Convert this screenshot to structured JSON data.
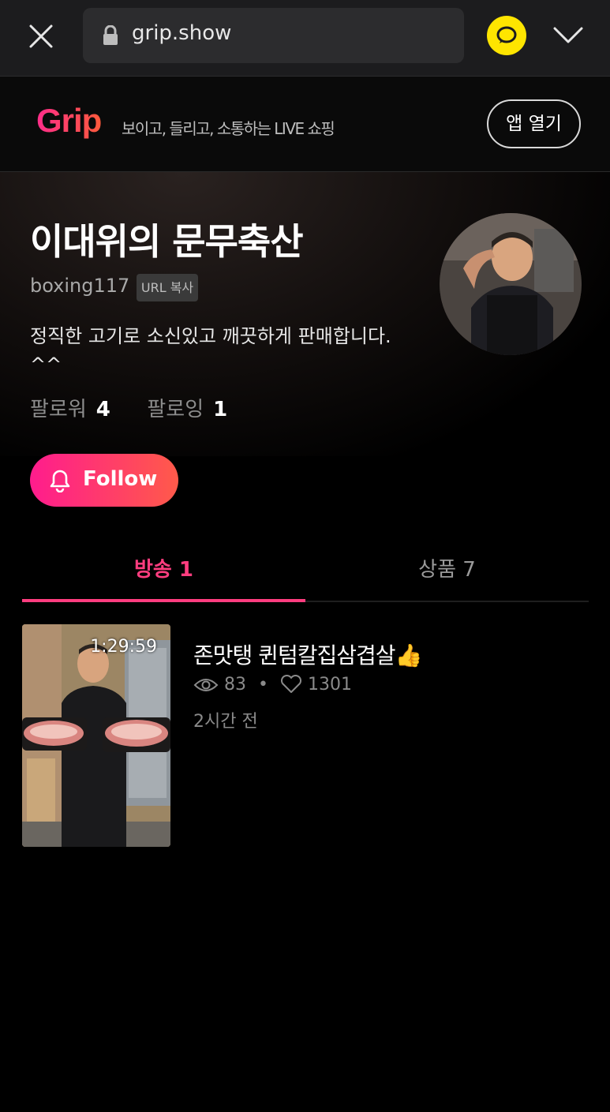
{
  "browser": {
    "url": "grip.show",
    "close_icon": "close-icon",
    "lock_icon": "lock-icon",
    "chat_icon": "kakaotalk-icon",
    "menu_icon": "chevron-down-icon"
  },
  "header": {
    "logo": "Grip",
    "tagline": "보이고, 들리고, 소통하는 LIVE 쇼핑",
    "open_app_label": "앱 열기",
    "brand_color": "#ff2d8a"
  },
  "profile": {
    "name": "이대위의 문무축산",
    "user_id": "boxing117",
    "url_copy_label": "URL 복사",
    "description": "정직한 고기로 소신있고 깨끗하게 판매합니다. ^^",
    "followers_label": "팔로워",
    "followers_count": "4",
    "following_label": "팔로잉",
    "following_count": "1",
    "follow_label": "Follow"
  },
  "tabs": [
    {
      "label": "방송 1",
      "active": true
    },
    {
      "label": "상품 7",
      "active": false
    }
  ],
  "broadcasts": [
    {
      "duration": "1:29:59",
      "title": "존맛탱 퀸텀칼집삼겹살👍",
      "views": "83",
      "likes": "1301",
      "time_ago": "2시간 전"
    }
  ],
  "colors": {
    "accent": "#ff3d7f",
    "kakao_yellow": "#fee500"
  }
}
